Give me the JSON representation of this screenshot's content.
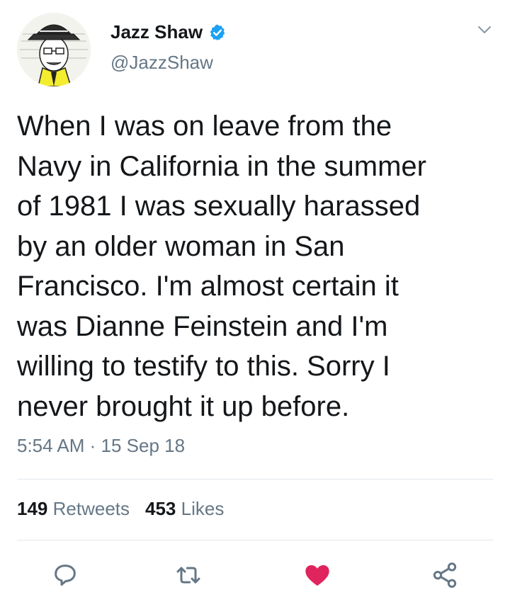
{
  "author": {
    "display_name": "Jazz Shaw",
    "handle": "@JazzShaw",
    "verified": true,
    "avatar_icon": "cartoon-avatar-icon"
  },
  "tweet": {
    "text": "When I was on leave from the\nNavy in California in the summer\nof 1981 I was sexually harassed\nby an older woman in San\nFrancisco. I'm almost certain it\nwas Dianne Feinstein and I'm\nwilling to testify to this. Sorry I\nnever brought it up before.",
    "timestamp": "5:54 AM · 15 Sep 18"
  },
  "stats": {
    "retweets_count": "149",
    "retweets_label": "Retweets",
    "likes_count": "453",
    "likes_label": "Likes"
  },
  "actions": {
    "reply_icon": "reply-icon",
    "retweet_icon": "retweet-icon",
    "like_icon": "heart-icon",
    "share_icon": "share-icon",
    "liked": true
  },
  "colors": {
    "accent_blue": "#1da1f2",
    "like_red": "#e0245e",
    "secondary_text": "#657786",
    "primary_text": "#14171a"
  }
}
